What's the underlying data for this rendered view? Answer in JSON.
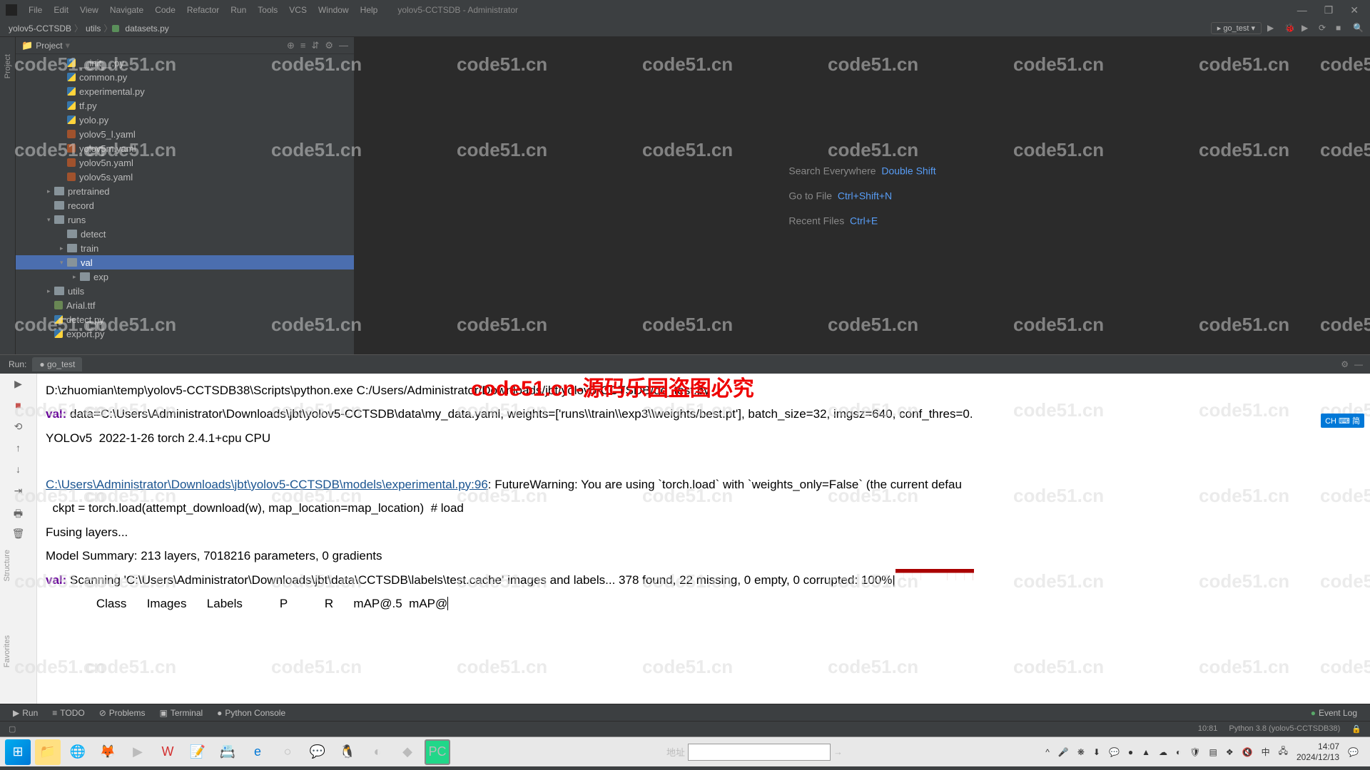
{
  "window": {
    "title": "yolov5-CCTSDB - Administrator"
  },
  "menu": [
    "File",
    "Edit",
    "View",
    "Navigate",
    "Code",
    "Refactor",
    "Run",
    "Tools",
    "VCS",
    "Window",
    "Help"
  ],
  "breadcrumb": {
    "root": "yolov5-CCTSDB",
    "folder": "utils",
    "file": "datasets.py"
  },
  "run_config": "go_test",
  "project": {
    "title": "Project",
    "tree": [
      {
        "name": "__init__.py",
        "type": "py",
        "indent": 3
      },
      {
        "name": "common.py",
        "type": "py",
        "indent": 3
      },
      {
        "name": "experimental.py",
        "type": "py",
        "indent": 3
      },
      {
        "name": "tf.py",
        "type": "py",
        "indent": 3
      },
      {
        "name": "yolo.py",
        "type": "py",
        "indent": 3
      },
      {
        "name": "yolov5_l.yaml",
        "type": "yaml",
        "indent": 3
      },
      {
        "name": "yolov5m.yaml",
        "type": "yaml",
        "indent": 3
      },
      {
        "name": "yolov5n.yaml",
        "type": "yaml",
        "indent": 3
      },
      {
        "name": "yolov5s.yaml",
        "type": "yaml",
        "indent": 3
      },
      {
        "name": "pretrained",
        "type": "folder",
        "indent": 2,
        "arrow": "▸"
      },
      {
        "name": "record",
        "type": "folder",
        "indent": 2
      },
      {
        "name": "runs",
        "type": "folder",
        "indent": 2,
        "arrow": "▾"
      },
      {
        "name": "detect",
        "type": "folder",
        "indent": 3
      },
      {
        "name": "train",
        "type": "folder",
        "indent": 3,
        "arrow": "▸"
      },
      {
        "name": "val",
        "type": "folder",
        "indent": 3,
        "arrow": "▾",
        "selected": true
      },
      {
        "name": "exp",
        "type": "folder",
        "indent": 4,
        "arrow": "▸"
      },
      {
        "name": "utils",
        "type": "folder",
        "indent": 2,
        "arrow": "▸"
      },
      {
        "name": "Arial.ttf",
        "type": "file",
        "indent": 2
      },
      {
        "name": "detect.py",
        "type": "py",
        "indent": 2
      },
      {
        "name": "export.py",
        "type": "py",
        "indent": 2
      }
    ]
  },
  "editor_hints": {
    "search": "Search Everywhere",
    "search_key": "Double Shift",
    "goto": "Go to File",
    "goto_key": "Ctrl+Shift+N",
    "recent": "Recent Files",
    "recent_key": "Ctrl+E"
  },
  "run": {
    "label": "Run:",
    "tab": "go_test"
  },
  "console": {
    "line1": "D:\\zhuomian\\temp\\yolov5-CCTSDB38\\Scripts\\python.exe C:/Users/Administrator/Downloads/jbt/yolov5-CCTSDB/go_test.py",
    "line2_kw": "val:",
    "line2": " data=C:\\Users\\Administrator\\Downloads\\jbt\\yolov5-CCTSDB\\data\\my_data.yaml, weights=['runs\\\\train\\\\exp3\\\\weights/best.pt'], batch_size=32, imgsz=640, conf_thres=0.",
    "line3": "YOLOv5  2022-1-26 torch 2.4.1+cpu CPU",
    "line4_link": "C:\\Users\\Administrator\\Downloads\\jbt\\yolov5-CCTSDB\\models\\experimental.py:96",
    "line4": ": FutureWarning: You are using `torch.load` with `weights_only=False` (the current defau",
    "line5": "  ckpt = torch.load(attempt_download(w), map_location=map_location)  # load",
    "line6": "Fusing layers...",
    "line7": "Model Summary: 213 layers, 7018216 parameters, 0 gradients",
    "line8_kw": "val:",
    "line8": " Scanning 'C:\\Users\\Administrator\\Downloads\\jbt\\data\\CCTSDB\\labels\\test.cache' images and labels... 378 found, 22 missing, 0 empty, 0 corrupted: 100%|",
    "line9": "               Class      Images      Labels           P           R      mAP@.5  mAP@"
  },
  "bottom_tabs": [
    "Run",
    "TODO",
    "Problems",
    "Terminal",
    "Python Console"
  ],
  "event_log": "Event Log",
  "status": {
    "pos": "10:81",
    "python": "Python 3.8 (yolov5-CCTSDB38)"
  },
  "taskbar": {
    "addr_label": "地址",
    "time": "14:07",
    "date": "2024/12/13"
  },
  "ime": "CH ⌨ 简",
  "overlay": "code51.cn-源码乐园盗图必究",
  "watermark": "code51.cn"
}
